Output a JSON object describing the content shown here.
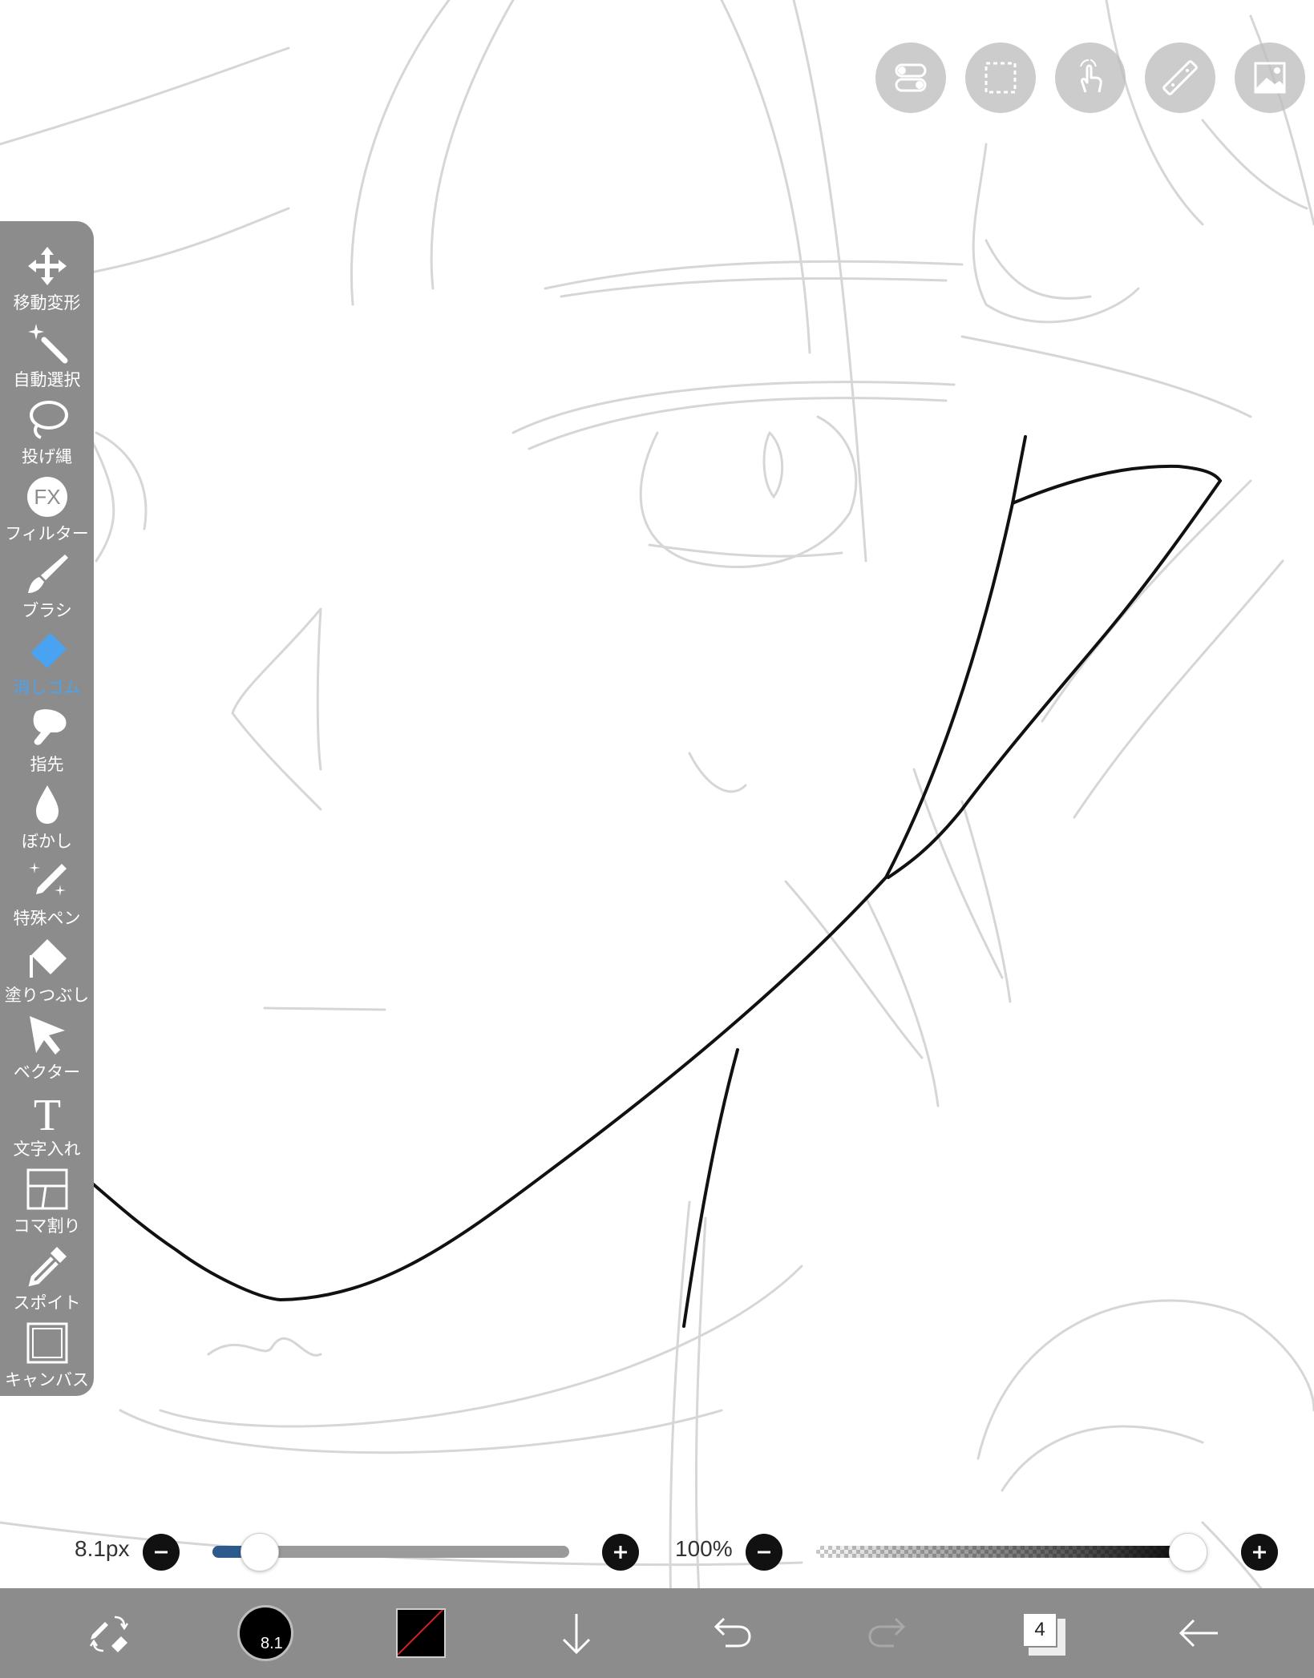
{
  "top_buttons": [
    {
      "name": "toggle-icon"
    },
    {
      "name": "selection-rect-icon"
    },
    {
      "name": "touch-gesture-icon"
    },
    {
      "name": "ruler-icon"
    },
    {
      "name": "image-layer-icon"
    }
  ],
  "toolbar": {
    "active_tool": "消しゴム",
    "accent_color": "#4aa3f0",
    "items": [
      {
        "label": "移動変形",
        "icon": "move-icon"
      },
      {
        "label": "自動選択",
        "icon": "magic-wand-icon"
      },
      {
        "label": "投げ縄",
        "icon": "lasso-icon"
      },
      {
        "label": "フィルター",
        "icon": "fx-icon"
      },
      {
        "label": "ブラシ",
        "icon": "brush-icon"
      },
      {
        "label": "消しゴム",
        "icon": "eraser-icon"
      },
      {
        "label": "指先",
        "icon": "finger-smudge-icon"
      },
      {
        "label": "ぼかし",
        "icon": "blur-drop-icon"
      },
      {
        "label": "特殊ペン",
        "icon": "special-pen-icon"
      },
      {
        "label": "塗りつぶし",
        "icon": "fill-bucket-icon"
      },
      {
        "label": "ベクター",
        "icon": "vector-arrow-icon"
      },
      {
        "label": "文字入れ",
        "icon": "text-icon"
      },
      {
        "label": "コマ割り",
        "icon": "panel-layout-icon"
      },
      {
        "label": "スポイト",
        "icon": "eyedropper-icon"
      },
      {
        "label": "キャンバス",
        "icon": "canvas-icon"
      }
    ]
  },
  "brush_size": {
    "label": "8.1px",
    "value_fraction": 0.13
  },
  "opacity": {
    "label": "100%",
    "value_fraction": 1.0
  },
  "bottom_bar": {
    "brush_preview_label": "8.1",
    "current_color": "#000000",
    "layer_count": "4"
  }
}
